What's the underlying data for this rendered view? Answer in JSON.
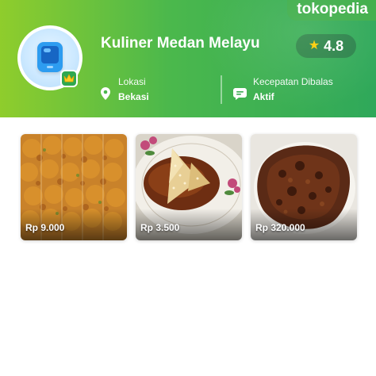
{
  "brand": {
    "name": "tokopedia"
  },
  "shop": {
    "name": "Kuliner Medan Melayu",
    "rating": "4.8",
    "location_label": "Lokasi",
    "location_value": "Bekasi",
    "response_label": "Kecepatan Dibalas",
    "response_value": "Aktif"
  },
  "products": [
    {
      "price": "Rp 9.000",
      "image": "fried-snacks-photo"
    },
    {
      "price": "Rp 3.500",
      "image": "sticky-rice-cake-photo"
    },
    {
      "price": "Rp 320.000",
      "image": "beef-rendang-photo"
    }
  ],
  "colors": {
    "header_start": "#8fcd2c",
    "header_end": "#2fa85a",
    "star": "#ffcc00"
  }
}
